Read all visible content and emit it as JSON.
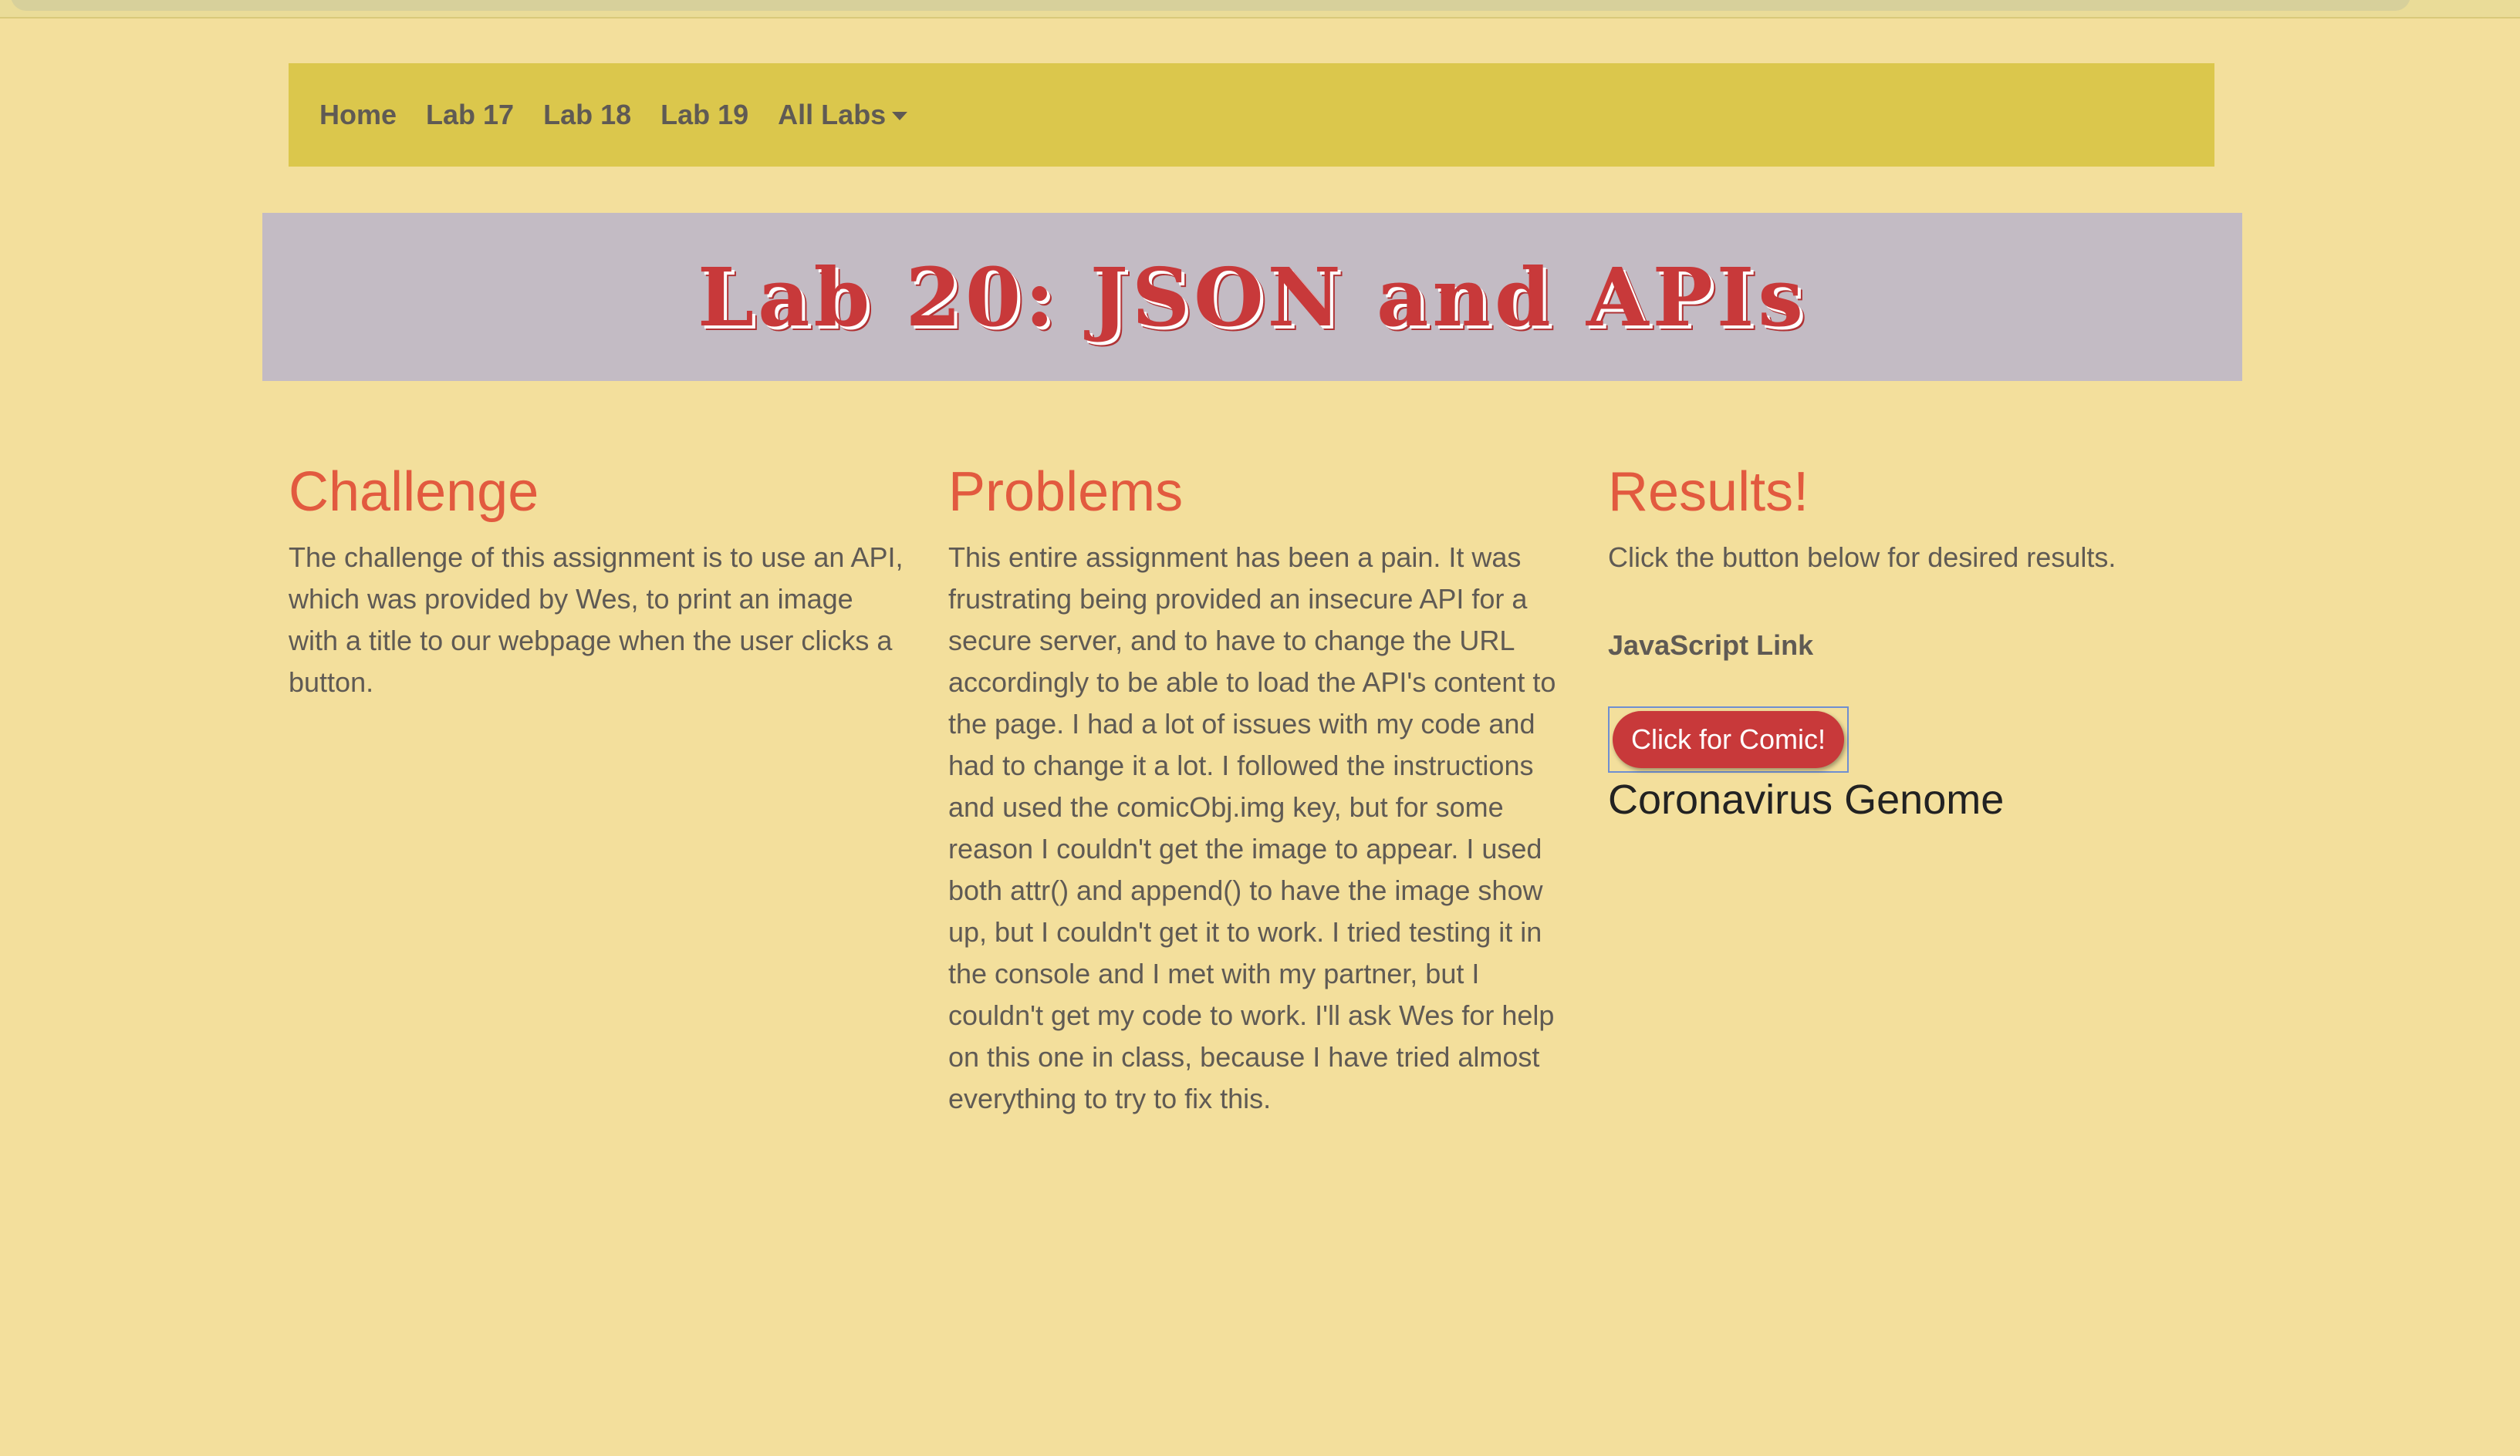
{
  "nav": {
    "items": [
      {
        "label": "Home"
      },
      {
        "label": "Lab 17"
      },
      {
        "label": "Lab 18"
      },
      {
        "label": "Lab 19"
      }
    ],
    "dropdown_label": "All Labs"
  },
  "banner": {
    "title": "Lab 20: JSON and APIs"
  },
  "challenge": {
    "heading": "Challenge",
    "text": "The challenge of this assignment is to use an API, which was provided by Wes, to print an image with a title to our webpage when the user clicks a button."
  },
  "problems": {
    "heading": "Problems",
    "text": "This entire assignment has been a pain. It was frustrating being provided an insecure API for a secure server, and to have to change the URL accordingly to be able to load the API's content to the page. I had a lot of issues with my code and had to change it a lot. I followed the instructions and used the comicObj.img key, but for some reason I couldn't get the image to appear. I used both attr() and append() to have the image show up, but I couldn't get it to work. I tried testing it in the console and I met with my partner, but I couldn't get my code to work. I'll ask Wes for help on this one in class, because I have tried almost everything to try to fix this."
  },
  "results": {
    "heading": "Results!",
    "text": "Click the button below for desired results.",
    "js_link": "JavaScript Link",
    "button_label": "Click for Comic!",
    "comic_title": "Coronavirus Genome"
  },
  "colors": {
    "background": "#f3df9c",
    "navbar": "#dbc74c",
    "banner": "#c3bbc4",
    "accent_red": "#c8393a",
    "heading_orange": "#e25a3f"
  }
}
